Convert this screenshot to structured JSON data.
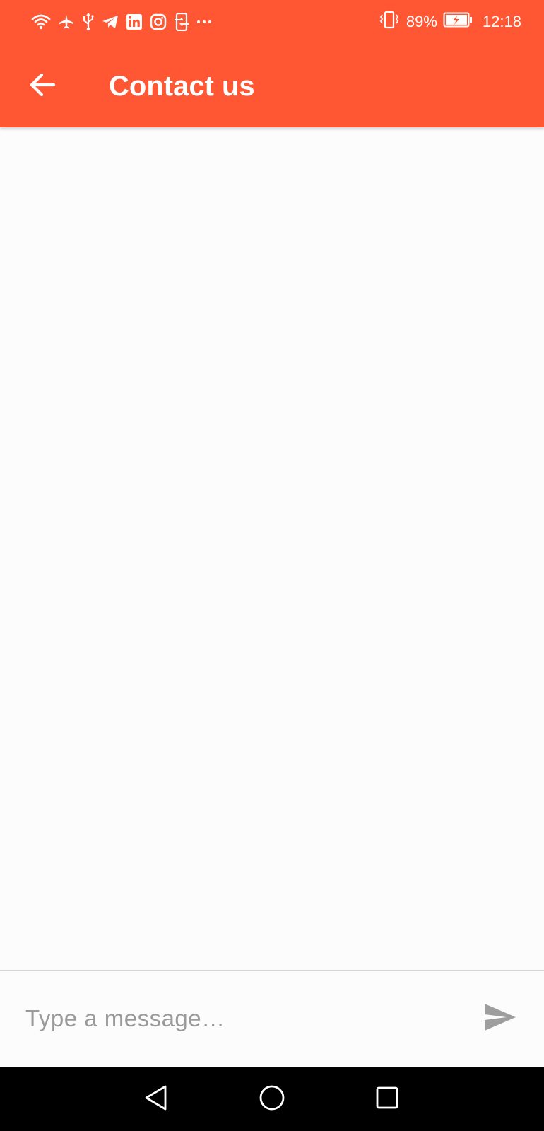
{
  "status_bar": {
    "battery_percent": "89%",
    "time": "12:18",
    "left_icons": [
      "wifi-icon",
      "airplane-icon",
      "usb-icon",
      "telegram-icon",
      "linkedin-icon",
      "instagram-icon",
      "phone-sync-icon",
      "more-dots-icon"
    ],
    "right_icons": [
      "vibrate-icon",
      "battery-charging-icon"
    ]
  },
  "app_bar": {
    "title": "Contact us",
    "back_icon": "arrow-left-icon"
  },
  "composer": {
    "placeholder": "Type a message…",
    "value": "",
    "send_icon": "send-icon"
  },
  "nav_bar": {
    "buttons": [
      "back-triangle-icon",
      "home-circle-icon",
      "recents-square-icon"
    ]
  },
  "colors": {
    "primary": "#ff5733",
    "background": "#fcfcfc",
    "placeholder": "#9a9a9a",
    "send_icon": "#9e9e9e",
    "nav_bar": "#000000"
  }
}
